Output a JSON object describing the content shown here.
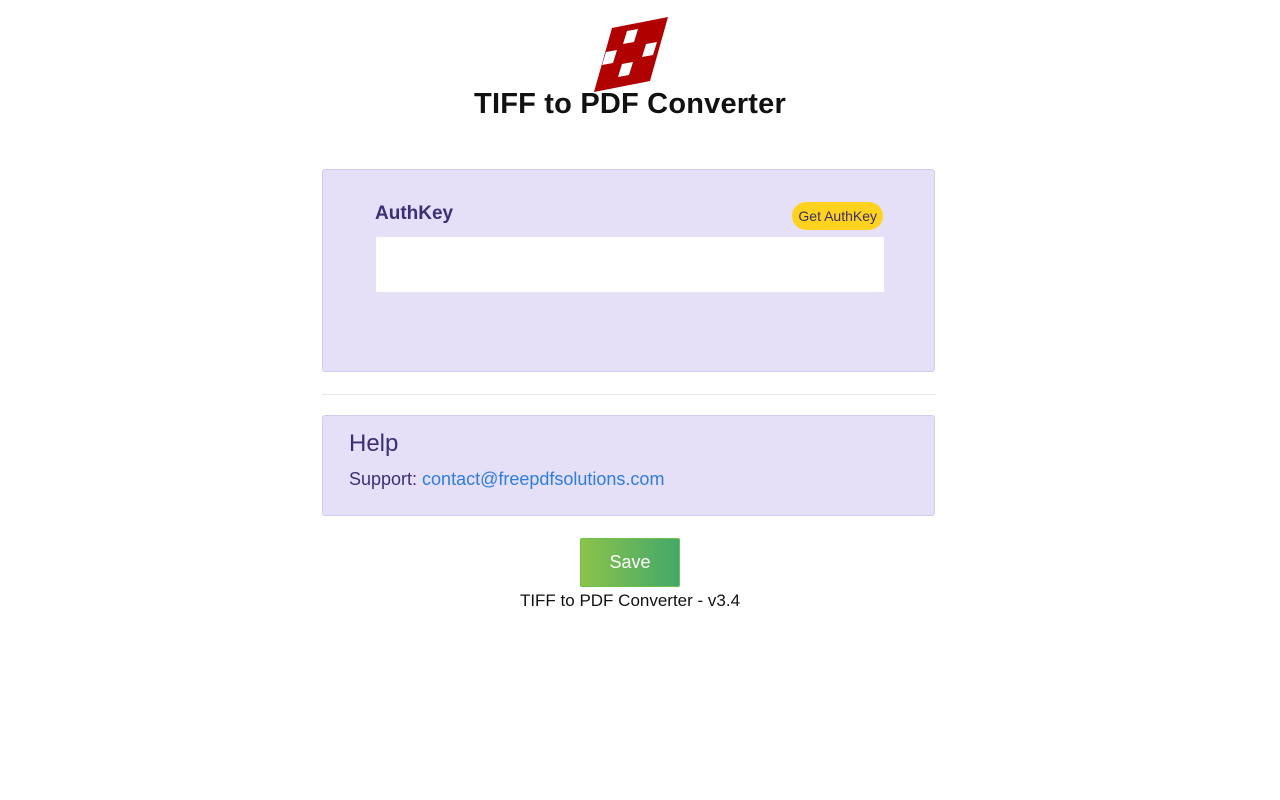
{
  "header": {
    "logo_icon": "tiff-to-pdf-logo-icon",
    "title": "TIFF to PDF Converter"
  },
  "auth": {
    "label": "AuthKey",
    "get_button_label": "Get AuthKey",
    "input_value": "",
    "input_placeholder": ""
  },
  "help": {
    "title": "Help",
    "support_prefix": "Support: ",
    "support_email": "contact@freepdfsolutions.com"
  },
  "actions": {
    "save_label": "Save"
  },
  "footer": {
    "version_text": "TIFF to PDF Converter - v3.4"
  },
  "colors": {
    "logo_red": "#b00000",
    "card_bg": "#e5dff8",
    "label_purple": "#3d2f75",
    "badge_yellow": "#ffd21f",
    "link_blue": "#2f7de1",
    "save_green_start": "#8bc34a",
    "save_green_end": "#43a86b"
  }
}
